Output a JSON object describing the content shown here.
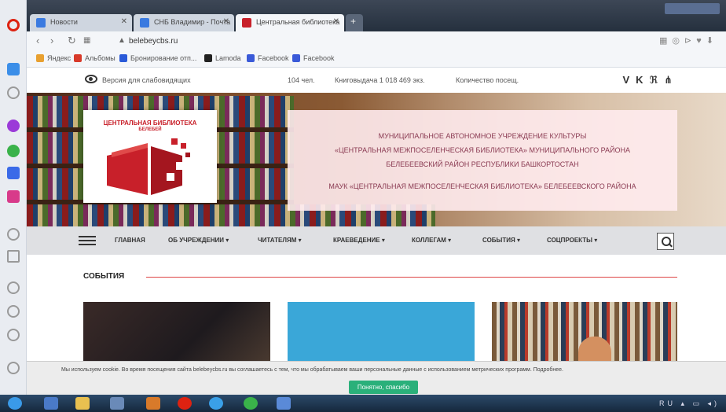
{
  "browser": {
    "tabs": [
      {
        "label": "Новости"
      },
      {
        "label": "СНБ Владимир - Почта"
      },
      {
        "label": "Центральная библиотека"
      }
    ],
    "url": "belebeycbs.ru",
    "bookmarks": [
      "Яндекс",
      "Альбомы",
      "Бронирование отп...",
      "Lamoda",
      "Facebook",
      "Facebook"
    ]
  },
  "site": {
    "accessibility": "Версия для слабовидящих",
    "counter1": "104 чел.",
    "counter2": "Книговыдача 1 018 469 экз.",
    "counter3": "Количество посещ.",
    "social_vk": "VK",
    "logo": {
      "line1": "ЦЕНТРАЛЬНАЯ БИБЛИОТЕКА",
      "line2": "БЕЛЕБЕЙ"
    },
    "header": {
      "line1": "МУНИЦИПАЛЬНОЕ АВТОНОМНОЕ УЧРЕЖДЕНИЕ КУЛЬТУРЫ",
      "line2": "«ЦЕНТРАЛЬНАЯ МЕЖПОСЕЛЕНЧЕСКАЯ БИБЛИОТЕКА» МУНИЦИПАЛЬНОГО РАЙОНА",
      "line3": "БЕЛЕБЕЕВСКИЙ РАЙОН РЕСПУБЛИКИ БАШКОРТОСТАН",
      "line4": "МАУК «ЦЕНТРАЛЬНАЯ МЕЖПОСЕЛЕНЧЕСКАЯ БИБЛИОТЕКА» БЕЛЕБЕЕВСКОГО РАЙОНА"
    },
    "nav": [
      "ГЛАВНАЯ",
      "ОБ УЧРЕЖДЕНИИ ▾",
      "ЧИТАТЕЛЯМ ▾",
      "КРАЕВЕДЕНИЕ ▾",
      "КОЛЛЕГАМ ▾",
      "СОБЫТИЯ ▾",
      "СОЦПРОЕКТЫ ▾"
    ],
    "events_title": "СОБЫТИЯ",
    "cookie_text": "Мы используем cookie. Во время посещения сайта belebeycbs.ru вы соглашаетесь с тем, что мы обрабатываем ваши персональные данные с использованием метрических программ. Подробнее.",
    "cookie_button": "Понятно, спасибо"
  }
}
